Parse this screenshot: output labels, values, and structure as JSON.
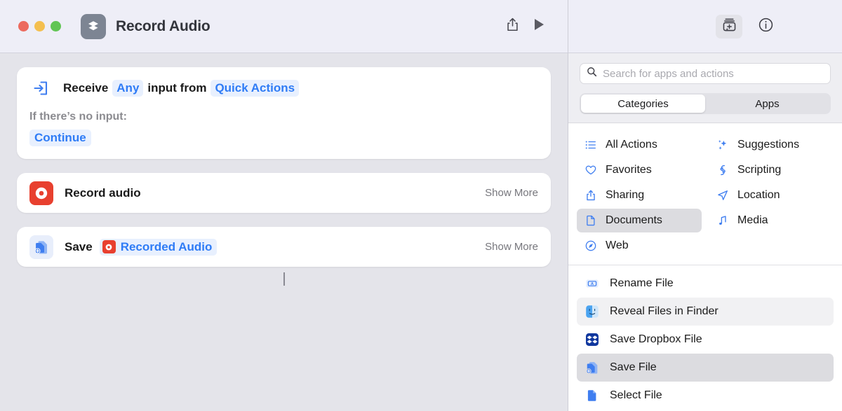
{
  "titlebar": {
    "document_title": "Record Audio",
    "app_icon": "shortcuts-layers-icon",
    "share_icon": "share-icon",
    "run_icon": "play-icon",
    "library_icon": "action-library-icon",
    "info_icon": "info-circle-icon",
    "traffic_lights": [
      "close",
      "minimize",
      "zoom"
    ]
  },
  "canvas": {
    "receive": {
      "icon": "receive-input-icon",
      "prefix": "Receive",
      "type_token": "Any",
      "middle": "input from",
      "source_token": "Quick Actions",
      "no_input_label": "If there’s no input:",
      "no_input_value": "Continue"
    },
    "actions": [
      {
        "icon": "record-audio-icon",
        "label": "Record audio",
        "show_more": "Show More"
      },
      {
        "icon": "save-file-icon",
        "label": "Save",
        "variable_token": "Recorded Audio",
        "variable_icon": "record-audio-icon",
        "show_more": "Show More"
      }
    ]
  },
  "sidebar": {
    "search": {
      "icon": "search-icon",
      "placeholder": "Search for apps and actions",
      "value": ""
    },
    "segmented": {
      "options": [
        "Categories",
        "Apps"
      ],
      "selected": "Categories"
    },
    "categories": [
      {
        "label": "All Actions",
        "icon": "list-bullet-icon",
        "selected": false
      },
      {
        "label": "Suggestions",
        "icon": "sparkles-icon",
        "selected": false
      },
      {
        "label": "Favorites",
        "icon": "heart-icon",
        "selected": false
      },
      {
        "label": "Scripting",
        "icon": "scripting-icon",
        "selected": false
      },
      {
        "label": "Sharing",
        "icon": "share-icon",
        "selected": false
      },
      {
        "label": "Location",
        "icon": "location-arrow-icon",
        "selected": false
      },
      {
        "label": "Documents",
        "icon": "document-icon",
        "selected": true
      },
      {
        "label": "Media",
        "icon": "music-note-icon",
        "selected": false
      },
      {
        "label": "Web",
        "icon": "compass-icon",
        "selected": false
      }
    ],
    "action_list": [
      {
        "label": "Rename File",
        "icon": "rename-file-icon",
        "state": "normal"
      },
      {
        "label": "Reveal Files in Finder",
        "icon": "finder-icon",
        "state": "hover"
      },
      {
        "label": "Save Dropbox File",
        "icon": "dropbox-icon",
        "state": "normal"
      },
      {
        "label": "Save File",
        "icon": "save-file-icon",
        "state": "selected"
      },
      {
        "label": "Select File",
        "icon": "select-file-icon",
        "state": "normal"
      }
    ]
  },
  "colors": {
    "accent_blue": "#2f7cf6",
    "record_red": "#e8402f",
    "canvas_bg": "#e4e4ea",
    "titlebar_bg": "#eeeef7",
    "selected_row": "#dcdce0"
  }
}
